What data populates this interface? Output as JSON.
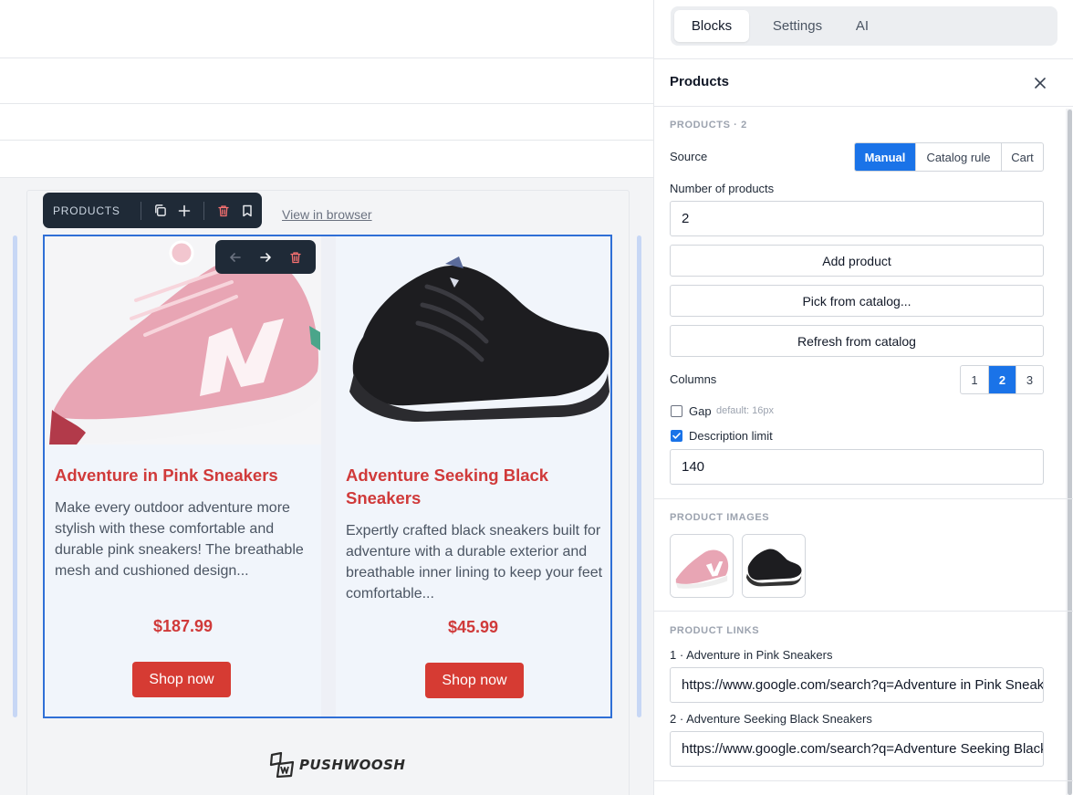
{
  "toolbar": {
    "label": "PRODUCTS"
  },
  "email": {
    "view_link": "View in browser",
    "products": [
      {
        "title": "Adventure in Pink Sneakers",
        "description": "Make every outdoor adventure more stylish with these comfortable and durable pink sneakers! The breathable mesh and cushioned design...",
        "price": "$187.99",
        "button": "Shop now"
      },
      {
        "title": "Adventure Seeking Black Sneakers",
        "description": "Expertly crafted black sneakers built for adventure with a durable exterior and breathable inner lining to keep your feet comfortable...",
        "price": "$45.99",
        "button": "Shop now"
      }
    ],
    "logo_text": "PUSHWOOSH"
  },
  "panel": {
    "tabs": [
      {
        "label": "Blocks",
        "active": true
      },
      {
        "label": "Settings",
        "active": false
      },
      {
        "label": "AI",
        "active": false
      }
    ],
    "title": "Products",
    "section_products": "PRODUCTS · 2",
    "source_label": "Source",
    "source_options": [
      "Manual",
      "Catalog rule",
      "Cart"
    ],
    "source_selected": "Manual",
    "num_products_label": "Number of products",
    "num_products_value": "2",
    "add_product": "Add product",
    "pick_catalog": "Pick from catalog...",
    "refresh_catalog": "Refresh from catalog",
    "columns_label": "Columns",
    "columns_options": [
      "1",
      "2",
      "3"
    ],
    "columns_selected": "2",
    "gap_label": "Gap",
    "gap_hint": "default: 16px",
    "gap_checked": false,
    "desc_limit_label": "Description limit",
    "desc_limit_checked": true,
    "desc_limit_value": "140",
    "section_images": "PRODUCT IMAGES",
    "section_links": "PRODUCT LINKS",
    "links": [
      {
        "label": "1 · Adventure in Pink Sneakers",
        "url": "https://www.google.com/search?q=Adventure in Pink Sneakers"
      },
      {
        "label": "2 · Adventure Seeking Black Sneakers",
        "url": "https://www.google.com/search?q=Adventure Seeking Black Sneakers"
      }
    ]
  },
  "colors": {
    "accent": "#1a73e8",
    "brand_red": "#d03a3a",
    "button_red": "#d63b33",
    "selection": "#2f6fd6"
  }
}
